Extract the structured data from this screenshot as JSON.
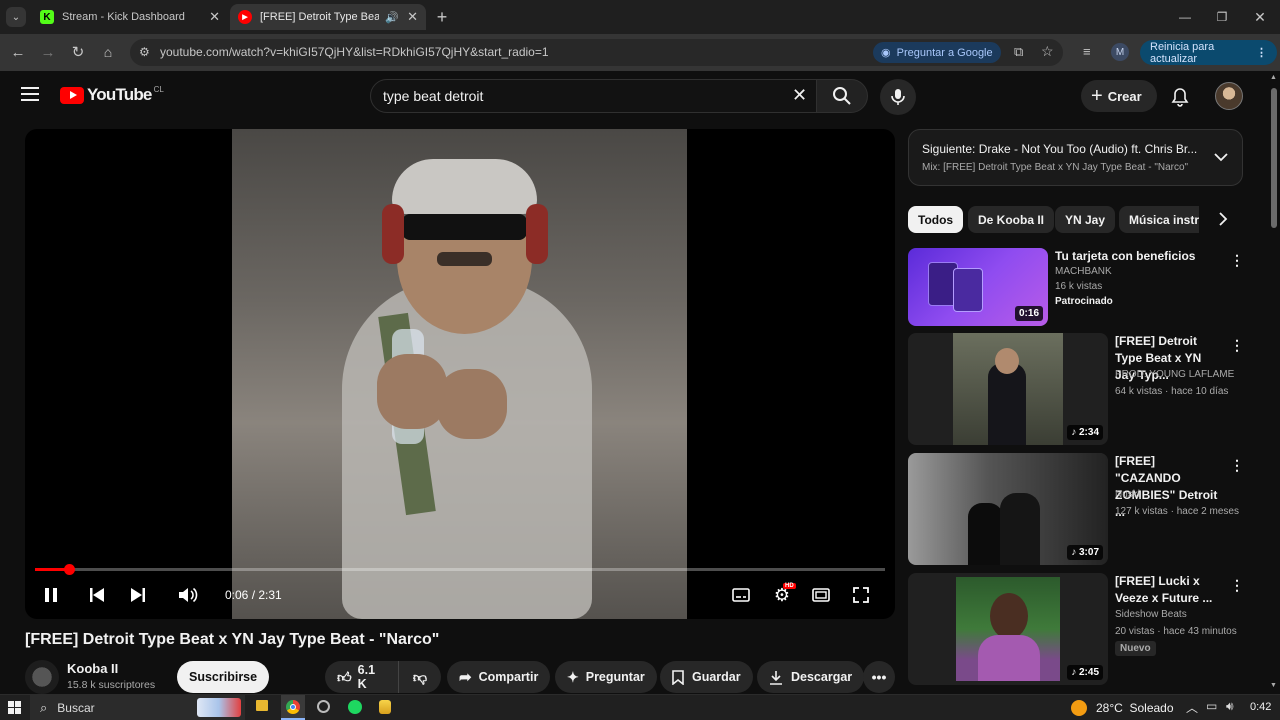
{
  "browser": {
    "tabs": [
      {
        "title": "Stream - Kick Dashboard",
        "favicon": "K"
      },
      {
        "title": "[FREE] Detroit Type Beat x Y",
        "favicon": "▶"
      }
    ],
    "url": "youtube.com/watch?v=khiGI57QjHY&list=RDkhiGI57QjHY&start_radio=1",
    "ask_google": "Preguntar a Google",
    "profile_initial": "M",
    "restart_label": "Reinicia para actualizar"
  },
  "youtube": {
    "logo_text": "YouTube",
    "region": "CL",
    "search_value": "type beat detroit",
    "create_label": "Crear"
  },
  "player": {
    "time": "0:06 / 2:31",
    "progress": 0.04,
    "hd_badge": "HD"
  },
  "video": {
    "title": "[FREE] Detroit Type Beat x YN Jay Type Beat - \"Narco\"",
    "channel": "Kooba II",
    "subscribers": "15.8 k suscriptores",
    "subscribe_label": "Suscribirse",
    "likes": "6.1 K",
    "share_label": "Compartir",
    "ask_label": "Preguntar",
    "save_label": "Guardar",
    "download_label": "Descargar"
  },
  "up_next": {
    "title": "Siguiente: Drake - Not You Too (Audio) ft. Chris Br...",
    "subtitle": "Mix: [FREE] Detroit Type Beat x YN Jay Type Beat - \"Narco\""
  },
  "chips": [
    "Todos",
    "De Kooba II",
    "YN Jay",
    "Música instr"
  ],
  "recommendations": [
    {
      "title": "Tu tarjeta con beneficios",
      "channel": "MACHBANK",
      "meta": "16 k vistas",
      "badge": "Patrocinado",
      "duration": "0:16"
    },
    {
      "title": "[FREE] Detroit Type Beat x YN Jay Typ...",
      "channel": "PROD. YOUNG LAFLAME",
      "meta": "64 k vistas · hace 10 días",
      "badge": "",
      "duration": "2:34"
    },
    {
      "title": "[FREE] \"CAZANDO ZOMBIES\" Detroit ...",
      "channel": "Nuski",
      "meta": "127 k vistas · hace 2 meses",
      "badge": "",
      "duration": "3:07"
    },
    {
      "title": "[FREE] Lucki x Veeze x Future ...",
      "channel": "Sideshow Beats",
      "meta": "20 vistas · hace 43 minutos",
      "badge": "Nuevo",
      "duration": "2:45"
    }
  ],
  "taskbar": {
    "search_label": "Buscar",
    "weather": "28°C  Soleado",
    "clock": "0:42"
  }
}
